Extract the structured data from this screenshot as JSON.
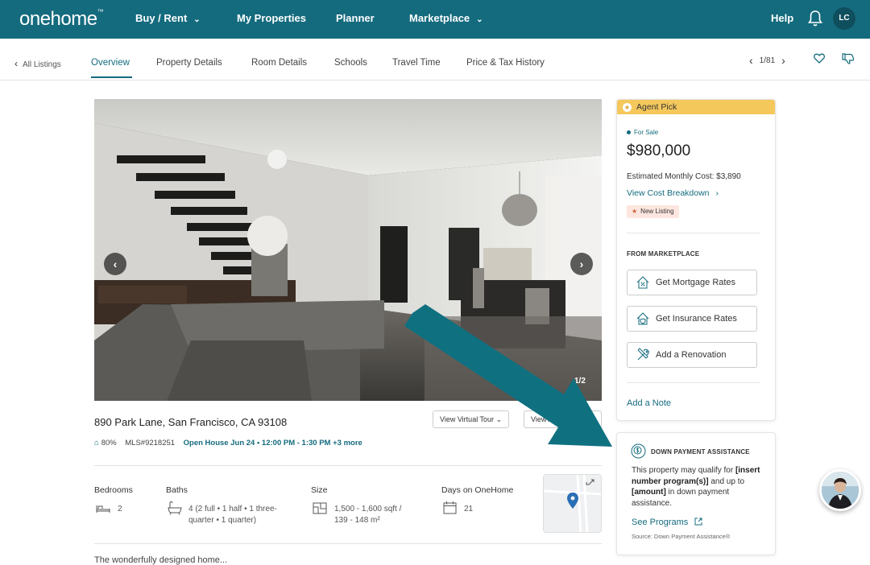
{
  "header": {
    "logo": "onehome",
    "logo_tm": "™",
    "nav": [
      {
        "label": "Buy / Rent",
        "has_dropdown": true
      },
      {
        "label": "My Properties",
        "has_dropdown": false
      },
      {
        "label": "Planner",
        "has_dropdown": false
      },
      {
        "label": "Marketplace",
        "has_dropdown": true
      }
    ],
    "help": "Help",
    "user_initials": "LC"
  },
  "subnav": {
    "back": "All Listings",
    "tabs": [
      "Overview",
      "Property Details",
      "Room Details",
      "Schools",
      "Travel Time",
      "Price & Tax History"
    ],
    "active_tab": "Overview",
    "pager": "1/81"
  },
  "photo": {
    "counter": "1/2"
  },
  "listing": {
    "address": "890 Park Lane, San Francisco, CA 93108",
    "virtual_tour": "View Virtual Tour",
    "view_all": "View All",
    "match": "80%",
    "mls": "MLS#9218251",
    "open_house": "Open House Jun 24  •  12:00 PM - 1:30 PM +3 more",
    "facts": {
      "bedrooms_label": "Bedrooms",
      "bedrooms": "2",
      "baths_label": "Baths",
      "baths_line1": "4  (2 full • 1 half • 1 three-",
      "baths_line2": "quarter • 1 quarter)",
      "size_label": "Size",
      "size_line1": "1,500 - 1,600 sqft /",
      "size_line2": "139 - 148 m²",
      "days_label": "Days on OneHome",
      "days": "21"
    },
    "description_peek": "The wonderfully designed home..."
  },
  "sidecard": {
    "badge": "Agent Pick",
    "status": "For Sale",
    "price": "$980,000",
    "estimated": "Estimated Monthly Cost: $3,890",
    "cost_link": "View Cost Breakdown",
    "tag": "New Listing",
    "marketplace_heading": "FROM MARKETPLACE",
    "buttons": [
      "Get Mortgage Rates",
      "Get Insurance Rates",
      "Add a Renovation"
    ],
    "add_note": "Add a Note"
  },
  "dpa": {
    "title": "DOWN PAYMENT ASSISTANCE",
    "body_1": "This property may qualify for ",
    "body_2": "[insert number program(s)]",
    "body_3": " and up to ",
    "body_4": "[amount]",
    "body_5": " in down payment assistance.",
    "link": "See Programs",
    "source": "Source: Down Payment Assistance®"
  },
  "colors": {
    "brand": "#146b7e",
    "agent_pick": "#f5c85c",
    "new_listing_bg": "#fde6df",
    "arrow": "#0f7080"
  }
}
